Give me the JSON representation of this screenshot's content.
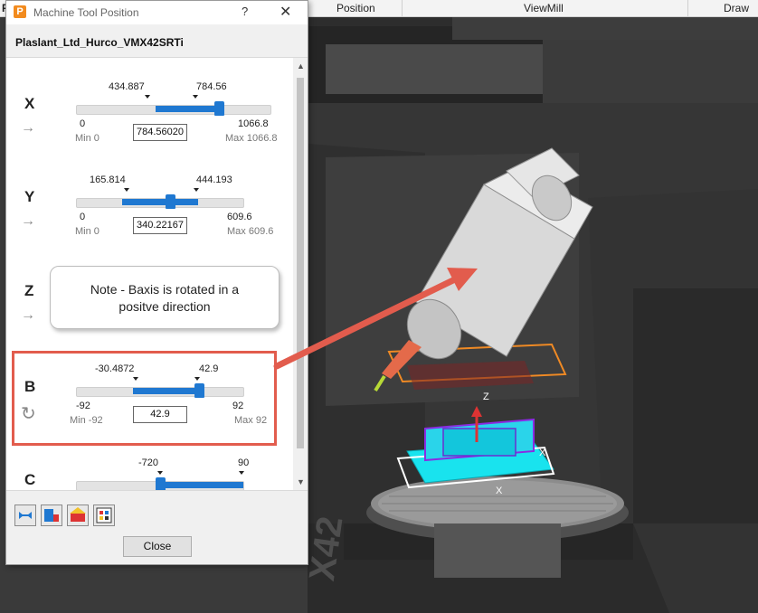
{
  "ribbon": {
    "tabs": [
      "Position",
      "ViewMill",
      "Draw"
    ],
    "left_glyph": "P"
  },
  "dialog": {
    "app_icon_glyph": "P",
    "title": "Machine Tool Position",
    "help": "?",
    "close": "✕",
    "machine": "Plaslant_Ltd_Hurco_VMX42SRTi",
    "close_label": "Close",
    "tool_buttons": [
      "move-to-tool-icon",
      "machine-position-icon",
      "home-icon",
      "settings-grid-icon"
    ]
  },
  "axes": {
    "x": {
      "letter": "X",
      "icon": "→",
      "lower": "434.887",
      "upper": "784.56",
      "min": "0",
      "max": "1066.8",
      "min_label": "Min 0",
      "max_label": "Max 1066.8",
      "value": "784.56020",
      "range_lo": 434.887,
      "range_hi": 784.56,
      "limit_lo": 0,
      "limit_hi": 1066.8
    },
    "y": {
      "letter": "Y",
      "icon": "→",
      "lower": "165.814",
      "upper": "444.193",
      "min": "0",
      "max": "609.6",
      "min_label": "Min 0",
      "max_label": "Max 609.6",
      "value": "340.22167",
      "range_lo": 165.814,
      "range_hi": 444.193,
      "limit_lo": 0,
      "limit_hi": 609.6
    },
    "z": {
      "letter": "Z",
      "icon": "→"
    },
    "b": {
      "letter": "B",
      "icon": "↻",
      "lower": "-30.4872",
      "upper": "42.9",
      "min": "-92",
      "max": "92",
      "min_label": "Min -92",
      "max_label": "Max 92",
      "value": "42.9",
      "range_lo": -30.4872,
      "range_hi": 42.9,
      "limit_lo": -92,
      "limit_hi": 92
    },
    "c": {
      "letter": "C",
      "lower": "-720",
      "upper": "90"
    }
  },
  "note": {
    "line1": "Note - Baxis is rotated in a",
    "line2": "positve direction"
  },
  "scene_labels": {
    "z": "Z",
    "x": "X",
    "x2": "X",
    "brand": "X42"
  },
  "colors": {
    "accent": "#1f78d1",
    "highlight": "#e25c4d",
    "part": "#19e3ee",
    "fixture": "#f08a24"
  }
}
